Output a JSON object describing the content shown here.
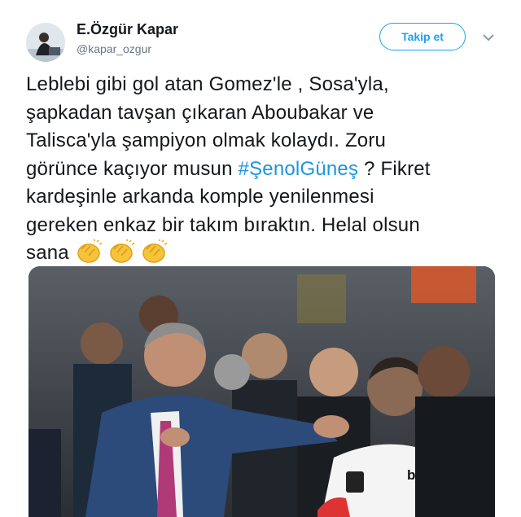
{
  "author": {
    "display_name": "E.Özgür Kapar",
    "handle": "@kapar_ozgur"
  },
  "actions": {
    "follow_label": "Takip et",
    "menu_icon": "chevron-down-icon"
  },
  "tweet": {
    "lines": [
      "Leblebi gibi gol atan Gomez'le , Sosa'yla,",
      "şapkadan tavşan çıkaran Aboubakar ve",
      "Talisca'yla şampiyon olmak kolaydı. Zoru",
      "görünce kaçıyor musun ",
      " ? Fikret",
      "kardeşinle arkanda komple yenilenmesi",
      "gereken enkaz bir takım bıraktın. Helal olsun",
      "sana"
    ],
    "hashtag": "#ŞenolGüneş",
    "emoji": [
      "clapping-hands-icon",
      "clapping-hands-icon",
      "clapping-hands-icon"
    ]
  },
  "media": {
    "shirt_sponsor": "beko",
    "description_icon": "photo-football-celebration"
  },
  "colors": {
    "link": "#1b95e0",
    "follow_border": "#1da1f2",
    "text": "#14171a",
    "muted": "#657786"
  }
}
